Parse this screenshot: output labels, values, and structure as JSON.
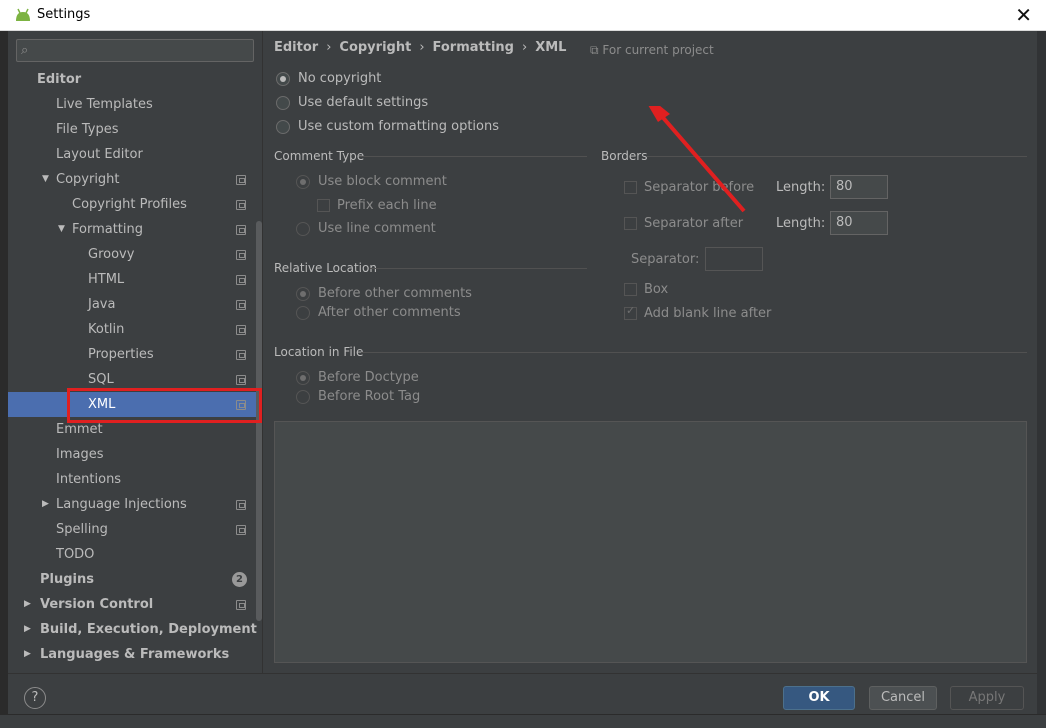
{
  "window": {
    "title": "Settings"
  },
  "search": {
    "placeholder": ""
  },
  "sidebar": {
    "items": [
      {
        "label": "Editor",
        "level": 0,
        "bold": true
      },
      {
        "label": "Live Templates",
        "level": 1
      },
      {
        "label": "File Types",
        "level": 1
      },
      {
        "label": "Layout Editor",
        "level": 1
      },
      {
        "label": "Copyright",
        "level": 1,
        "expanded": true,
        "proj": true
      },
      {
        "label": "Copyright Profiles",
        "level": 2,
        "proj": true
      },
      {
        "label": "Formatting",
        "level": 2,
        "expanded": true,
        "proj": true
      },
      {
        "label": "Groovy",
        "level": 3,
        "proj": true
      },
      {
        "label": "HTML",
        "level": 3,
        "proj": true
      },
      {
        "label": "Java",
        "level": 3,
        "proj": true
      },
      {
        "label": "Kotlin",
        "level": 3,
        "proj": true
      },
      {
        "label": "Properties",
        "level": 3,
        "proj": true
      },
      {
        "label": "SQL",
        "level": 3,
        "proj": true
      },
      {
        "label": "XML",
        "level": 3,
        "proj": true,
        "selected": true
      },
      {
        "label": "Emmet",
        "level": 1
      },
      {
        "label": "Images",
        "level": 1
      },
      {
        "label": "Intentions",
        "level": 1
      },
      {
        "label": "Language Injections",
        "level": 1,
        "collapsed": true,
        "proj": true
      },
      {
        "label": "Spelling",
        "level": 1,
        "proj": true
      },
      {
        "label": "TODO",
        "level": 1
      },
      {
        "label": "Plugins",
        "level": 0,
        "bold": true,
        "badge": "2"
      },
      {
        "label": "Version Control",
        "level": 0,
        "bold": true,
        "collapsed": true,
        "proj": true
      },
      {
        "label": "Build, Execution, Deployment",
        "level": 0,
        "bold": true,
        "collapsed": true
      },
      {
        "label": "Languages & Frameworks",
        "level": 0,
        "bold": true,
        "collapsed": true
      }
    ]
  },
  "breadcrumb": [
    "Editor",
    "Copyright",
    "Formatting",
    "XML"
  ],
  "for_project": "For current project",
  "copyright_mode": {
    "no_copyright": "No copyright",
    "use_default": "Use default settings",
    "use_custom": "Use custom formatting options",
    "selected": "no_copyright"
  },
  "comment_type": {
    "title": "Comment Type",
    "block": "Use block comment",
    "prefix": "Prefix each line",
    "line": "Use line comment"
  },
  "relative_location": {
    "title": "Relative Location",
    "before": "Before other comments",
    "after": "After other comments"
  },
  "borders": {
    "title": "Borders",
    "sep_before": "Separator before",
    "sep_after": "Separator after",
    "length_label": "Length:",
    "length_before": "80",
    "length_after": "80",
    "separator_label": "Separator:",
    "separator_value": "",
    "box": "Box",
    "blank_line": "Add blank line after"
  },
  "location_in_file": {
    "title": "Location in File",
    "before_doctype": "Before Doctype",
    "before_root": "Before Root Tag"
  },
  "footer": {
    "help": "?",
    "ok": "OK",
    "cancel": "Cancel",
    "apply": "Apply"
  }
}
